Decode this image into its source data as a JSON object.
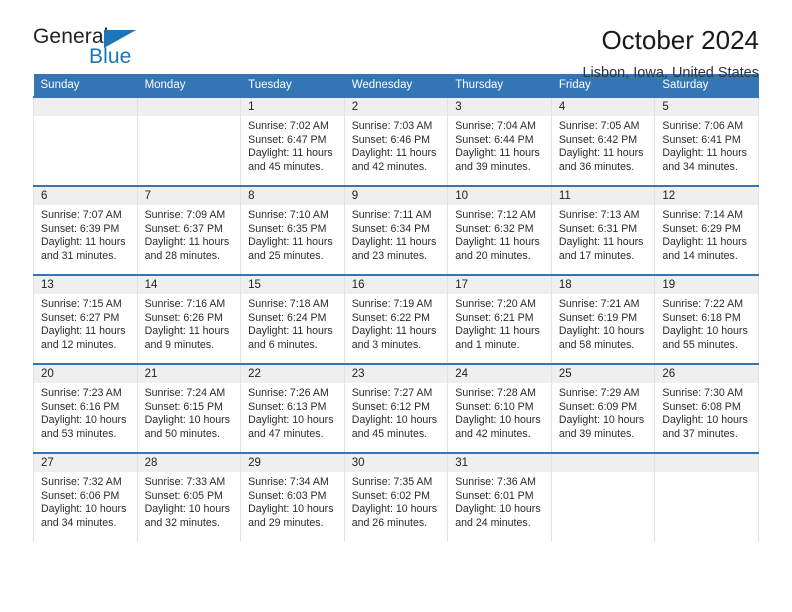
{
  "brand": {
    "name_top": "General",
    "name_bottom": "Blue",
    "triangle_color": "#1b75bb",
    "text_color": "#232323"
  },
  "header": {
    "title": "October 2024",
    "subtitle": "Lisbon, Iowa, United States",
    "accent_color": "#3375b5"
  },
  "calendar": {
    "weekday_headers": [
      "Sunday",
      "Monday",
      "Tuesday",
      "Wednesday",
      "Thursday",
      "Friday",
      "Saturday"
    ],
    "labels": {
      "sunrise": "Sunrise:",
      "sunset": "Sunset:",
      "daylight": "Daylight:"
    },
    "weeks": [
      [
        {
          "day": "",
          "sunrise": "",
          "sunset": "",
          "daylight": ""
        },
        {
          "day": "",
          "sunrise": "",
          "sunset": "",
          "daylight": ""
        },
        {
          "day": "1",
          "sunrise": "Sunrise: 7:02 AM",
          "sunset": "Sunset: 6:47 PM",
          "daylight": "Daylight: 11 hours and 45 minutes."
        },
        {
          "day": "2",
          "sunrise": "Sunrise: 7:03 AM",
          "sunset": "Sunset: 6:46 PM",
          "daylight": "Daylight: 11 hours and 42 minutes."
        },
        {
          "day": "3",
          "sunrise": "Sunrise: 7:04 AM",
          "sunset": "Sunset: 6:44 PM",
          "daylight": "Daylight: 11 hours and 39 minutes."
        },
        {
          "day": "4",
          "sunrise": "Sunrise: 7:05 AM",
          "sunset": "Sunset: 6:42 PM",
          "daylight": "Daylight: 11 hours and 36 minutes."
        },
        {
          "day": "5",
          "sunrise": "Sunrise: 7:06 AM",
          "sunset": "Sunset: 6:41 PM",
          "daylight": "Daylight: 11 hours and 34 minutes."
        }
      ],
      [
        {
          "day": "6",
          "sunrise": "Sunrise: 7:07 AM",
          "sunset": "Sunset: 6:39 PM",
          "daylight": "Daylight: 11 hours and 31 minutes."
        },
        {
          "day": "7",
          "sunrise": "Sunrise: 7:09 AM",
          "sunset": "Sunset: 6:37 PM",
          "daylight": "Daylight: 11 hours and 28 minutes."
        },
        {
          "day": "8",
          "sunrise": "Sunrise: 7:10 AM",
          "sunset": "Sunset: 6:35 PM",
          "daylight": "Daylight: 11 hours and 25 minutes."
        },
        {
          "day": "9",
          "sunrise": "Sunrise: 7:11 AM",
          "sunset": "Sunset: 6:34 PM",
          "daylight": "Daylight: 11 hours and 23 minutes."
        },
        {
          "day": "10",
          "sunrise": "Sunrise: 7:12 AM",
          "sunset": "Sunset: 6:32 PM",
          "daylight": "Daylight: 11 hours and 20 minutes."
        },
        {
          "day": "11",
          "sunrise": "Sunrise: 7:13 AM",
          "sunset": "Sunset: 6:31 PM",
          "daylight": "Daylight: 11 hours and 17 minutes."
        },
        {
          "day": "12",
          "sunrise": "Sunrise: 7:14 AM",
          "sunset": "Sunset: 6:29 PM",
          "daylight": "Daylight: 11 hours and 14 minutes."
        }
      ],
      [
        {
          "day": "13",
          "sunrise": "Sunrise: 7:15 AM",
          "sunset": "Sunset: 6:27 PM",
          "daylight": "Daylight: 11 hours and 12 minutes."
        },
        {
          "day": "14",
          "sunrise": "Sunrise: 7:16 AM",
          "sunset": "Sunset: 6:26 PM",
          "daylight": "Daylight: 11 hours and 9 minutes."
        },
        {
          "day": "15",
          "sunrise": "Sunrise: 7:18 AM",
          "sunset": "Sunset: 6:24 PM",
          "daylight": "Daylight: 11 hours and 6 minutes."
        },
        {
          "day": "16",
          "sunrise": "Sunrise: 7:19 AM",
          "sunset": "Sunset: 6:22 PM",
          "daylight": "Daylight: 11 hours and 3 minutes."
        },
        {
          "day": "17",
          "sunrise": "Sunrise: 7:20 AM",
          "sunset": "Sunset: 6:21 PM",
          "daylight": "Daylight: 11 hours and 1 minute."
        },
        {
          "day": "18",
          "sunrise": "Sunrise: 7:21 AM",
          "sunset": "Sunset: 6:19 PM",
          "daylight": "Daylight: 10 hours and 58 minutes."
        },
        {
          "day": "19",
          "sunrise": "Sunrise: 7:22 AM",
          "sunset": "Sunset: 6:18 PM",
          "daylight": "Daylight: 10 hours and 55 minutes."
        }
      ],
      [
        {
          "day": "20",
          "sunrise": "Sunrise: 7:23 AM",
          "sunset": "Sunset: 6:16 PM",
          "daylight": "Daylight: 10 hours and 53 minutes."
        },
        {
          "day": "21",
          "sunrise": "Sunrise: 7:24 AM",
          "sunset": "Sunset: 6:15 PM",
          "daylight": "Daylight: 10 hours and 50 minutes."
        },
        {
          "day": "22",
          "sunrise": "Sunrise: 7:26 AM",
          "sunset": "Sunset: 6:13 PM",
          "daylight": "Daylight: 10 hours and 47 minutes."
        },
        {
          "day": "23",
          "sunrise": "Sunrise: 7:27 AM",
          "sunset": "Sunset: 6:12 PM",
          "daylight": "Daylight: 10 hours and 45 minutes."
        },
        {
          "day": "24",
          "sunrise": "Sunrise: 7:28 AM",
          "sunset": "Sunset: 6:10 PM",
          "daylight": "Daylight: 10 hours and 42 minutes."
        },
        {
          "day": "25",
          "sunrise": "Sunrise: 7:29 AM",
          "sunset": "Sunset: 6:09 PM",
          "daylight": "Daylight: 10 hours and 39 minutes."
        },
        {
          "day": "26",
          "sunrise": "Sunrise: 7:30 AM",
          "sunset": "Sunset: 6:08 PM",
          "daylight": "Daylight: 10 hours and 37 minutes."
        }
      ],
      [
        {
          "day": "27",
          "sunrise": "Sunrise: 7:32 AM",
          "sunset": "Sunset: 6:06 PM",
          "daylight": "Daylight: 10 hours and 34 minutes."
        },
        {
          "day": "28",
          "sunrise": "Sunrise: 7:33 AM",
          "sunset": "Sunset: 6:05 PM",
          "daylight": "Daylight: 10 hours and 32 minutes."
        },
        {
          "day": "29",
          "sunrise": "Sunrise: 7:34 AM",
          "sunset": "Sunset: 6:03 PM",
          "daylight": "Daylight: 10 hours and 29 minutes."
        },
        {
          "day": "30",
          "sunrise": "Sunrise: 7:35 AM",
          "sunset": "Sunset: 6:02 PM",
          "daylight": "Daylight: 10 hours and 26 minutes."
        },
        {
          "day": "31",
          "sunrise": "Sunrise: 7:36 AM",
          "sunset": "Sunset: 6:01 PM",
          "daylight": "Daylight: 10 hours and 24 minutes."
        },
        {
          "day": "",
          "sunrise": "",
          "sunset": "",
          "daylight": ""
        },
        {
          "day": "",
          "sunrise": "",
          "sunset": "",
          "daylight": ""
        }
      ]
    ]
  }
}
